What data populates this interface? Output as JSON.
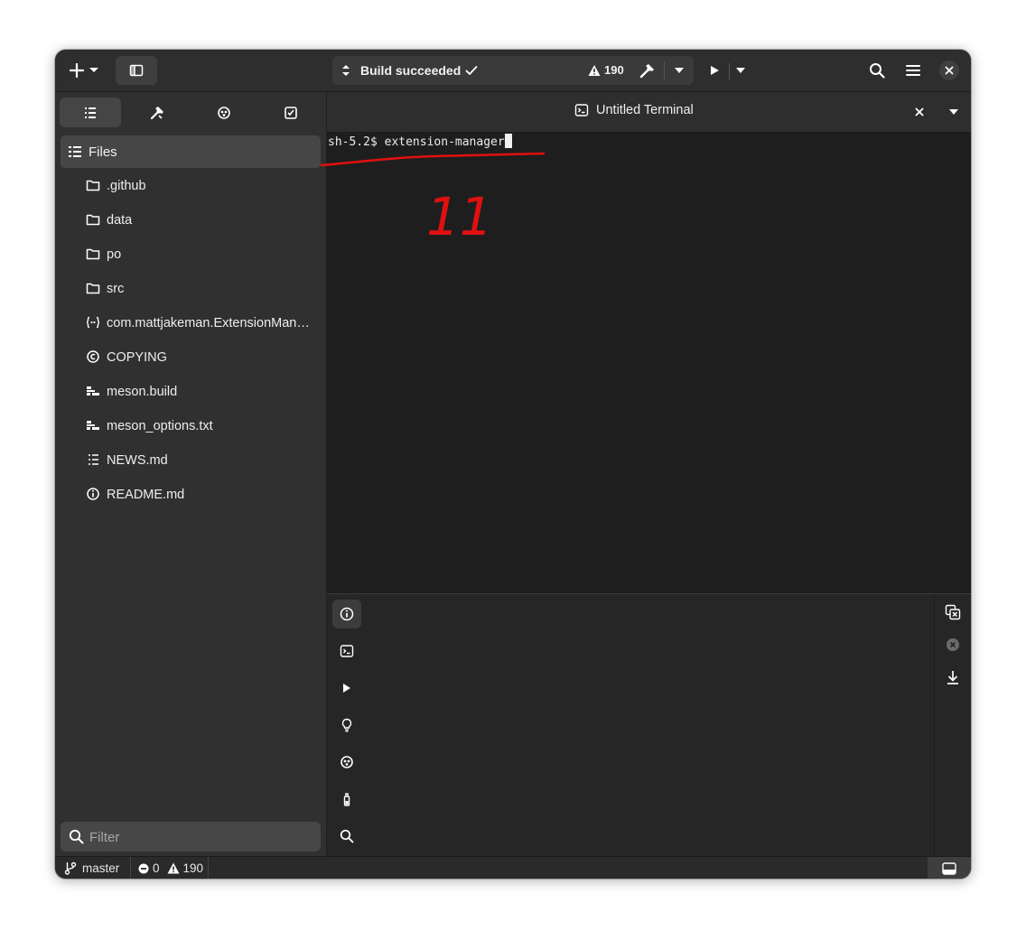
{
  "headerbar": {
    "build_status": "Build succeeded",
    "warning_count": "190"
  },
  "sidebar": {
    "tabs": [
      "files-tab",
      "build-tab",
      "symbols-tab",
      "todo-tab"
    ],
    "files_header": "Files",
    "items": [
      {
        "label": ".github",
        "icon": "folder-icon"
      },
      {
        "label": "data",
        "icon": "folder-icon"
      },
      {
        "label": "po",
        "icon": "folder-icon"
      },
      {
        "label": "src",
        "icon": "folder-icon"
      },
      {
        "label": "com.mattjakeman.ExtensionManager.json",
        "icon": "json-file-icon"
      },
      {
        "label": "COPYING",
        "icon": "copyright-icon"
      },
      {
        "label": "meson.build",
        "icon": "build-file-icon"
      },
      {
        "label": "meson_options.txt",
        "icon": "build-file-icon"
      },
      {
        "label": "NEWS.md",
        "icon": "markdown-list-icon"
      },
      {
        "label": "README.md",
        "icon": "info-file-icon"
      }
    ],
    "filter_placeholder": "Filter"
  },
  "terminal": {
    "tab_title": "Untitled Terminal",
    "prompt": "sh-5.2$ ",
    "command": "extension-manager"
  },
  "annotation": {
    "label": "11",
    "color": "#e01010"
  },
  "statusbar": {
    "branch": "master",
    "errors": "0",
    "warnings": "190"
  }
}
